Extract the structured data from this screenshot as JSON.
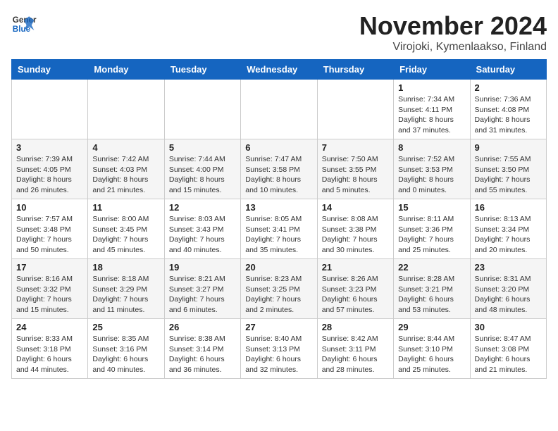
{
  "logo": {
    "line1": "General",
    "line2": "Blue"
  },
  "title": "November 2024",
  "location": "Virojoki, Kymenlaakso, Finland",
  "weekdays": [
    "Sunday",
    "Monday",
    "Tuesday",
    "Wednesday",
    "Thursday",
    "Friday",
    "Saturday"
  ],
  "weeks": [
    [
      {
        "day": "",
        "info": ""
      },
      {
        "day": "",
        "info": ""
      },
      {
        "day": "",
        "info": ""
      },
      {
        "day": "",
        "info": ""
      },
      {
        "day": "",
        "info": ""
      },
      {
        "day": "1",
        "info": "Sunrise: 7:34 AM\nSunset: 4:11 PM\nDaylight: 8 hours and 37 minutes."
      },
      {
        "day": "2",
        "info": "Sunrise: 7:36 AM\nSunset: 4:08 PM\nDaylight: 8 hours and 31 minutes."
      }
    ],
    [
      {
        "day": "3",
        "info": "Sunrise: 7:39 AM\nSunset: 4:05 PM\nDaylight: 8 hours and 26 minutes."
      },
      {
        "day": "4",
        "info": "Sunrise: 7:42 AM\nSunset: 4:03 PM\nDaylight: 8 hours and 21 minutes."
      },
      {
        "day": "5",
        "info": "Sunrise: 7:44 AM\nSunset: 4:00 PM\nDaylight: 8 hours and 15 minutes."
      },
      {
        "day": "6",
        "info": "Sunrise: 7:47 AM\nSunset: 3:58 PM\nDaylight: 8 hours and 10 minutes."
      },
      {
        "day": "7",
        "info": "Sunrise: 7:50 AM\nSunset: 3:55 PM\nDaylight: 8 hours and 5 minutes."
      },
      {
        "day": "8",
        "info": "Sunrise: 7:52 AM\nSunset: 3:53 PM\nDaylight: 8 hours and 0 minutes."
      },
      {
        "day": "9",
        "info": "Sunrise: 7:55 AM\nSunset: 3:50 PM\nDaylight: 7 hours and 55 minutes."
      }
    ],
    [
      {
        "day": "10",
        "info": "Sunrise: 7:57 AM\nSunset: 3:48 PM\nDaylight: 7 hours and 50 minutes."
      },
      {
        "day": "11",
        "info": "Sunrise: 8:00 AM\nSunset: 3:45 PM\nDaylight: 7 hours and 45 minutes."
      },
      {
        "day": "12",
        "info": "Sunrise: 8:03 AM\nSunset: 3:43 PM\nDaylight: 7 hours and 40 minutes."
      },
      {
        "day": "13",
        "info": "Sunrise: 8:05 AM\nSunset: 3:41 PM\nDaylight: 7 hours and 35 minutes."
      },
      {
        "day": "14",
        "info": "Sunrise: 8:08 AM\nSunset: 3:38 PM\nDaylight: 7 hours and 30 minutes."
      },
      {
        "day": "15",
        "info": "Sunrise: 8:11 AM\nSunset: 3:36 PM\nDaylight: 7 hours and 25 minutes."
      },
      {
        "day": "16",
        "info": "Sunrise: 8:13 AM\nSunset: 3:34 PM\nDaylight: 7 hours and 20 minutes."
      }
    ],
    [
      {
        "day": "17",
        "info": "Sunrise: 8:16 AM\nSunset: 3:32 PM\nDaylight: 7 hours and 15 minutes."
      },
      {
        "day": "18",
        "info": "Sunrise: 8:18 AM\nSunset: 3:29 PM\nDaylight: 7 hours and 11 minutes."
      },
      {
        "day": "19",
        "info": "Sunrise: 8:21 AM\nSunset: 3:27 PM\nDaylight: 7 hours and 6 minutes."
      },
      {
        "day": "20",
        "info": "Sunrise: 8:23 AM\nSunset: 3:25 PM\nDaylight: 7 hours and 2 minutes."
      },
      {
        "day": "21",
        "info": "Sunrise: 8:26 AM\nSunset: 3:23 PM\nDaylight: 6 hours and 57 minutes."
      },
      {
        "day": "22",
        "info": "Sunrise: 8:28 AM\nSunset: 3:21 PM\nDaylight: 6 hours and 53 minutes."
      },
      {
        "day": "23",
        "info": "Sunrise: 8:31 AM\nSunset: 3:20 PM\nDaylight: 6 hours and 48 minutes."
      }
    ],
    [
      {
        "day": "24",
        "info": "Sunrise: 8:33 AM\nSunset: 3:18 PM\nDaylight: 6 hours and 44 minutes."
      },
      {
        "day": "25",
        "info": "Sunrise: 8:35 AM\nSunset: 3:16 PM\nDaylight: 6 hours and 40 minutes."
      },
      {
        "day": "26",
        "info": "Sunrise: 8:38 AM\nSunset: 3:14 PM\nDaylight: 6 hours and 36 minutes."
      },
      {
        "day": "27",
        "info": "Sunrise: 8:40 AM\nSunset: 3:13 PM\nDaylight: 6 hours and 32 minutes."
      },
      {
        "day": "28",
        "info": "Sunrise: 8:42 AM\nSunset: 3:11 PM\nDaylight: 6 hours and 28 minutes."
      },
      {
        "day": "29",
        "info": "Sunrise: 8:44 AM\nSunset: 3:10 PM\nDaylight: 6 hours and 25 minutes."
      },
      {
        "day": "30",
        "info": "Sunrise: 8:47 AM\nSunset: 3:08 PM\nDaylight: 6 hours and 21 minutes."
      }
    ]
  ]
}
